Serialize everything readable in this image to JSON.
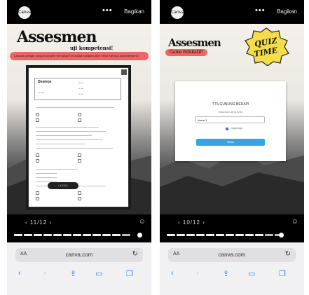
{
  "left": {
    "logo": "Canva",
    "menu_dots": "•••",
    "share": "Bagikan",
    "title": "Assesmen",
    "subtitle": "uji kompetensi!",
    "banner": "Lakukan dengan sunguh-sunguh! Semangat! Ini adalah tahapan akhir untuk menguji kompetensimu!",
    "doc_name": "Desmos",
    "counter": "‹  11/12  ›",
    "pager": "‹  11/12  ›",
    "url": "canva.com",
    "aa": "AA"
  },
  "right": {
    "logo": "Canva",
    "menu_dots": "•••",
    "share": "Bagikan",
    "title": "Assesmen",
    "pill": "Game Edukatif!",
    "quiz_line1": "QUIZ",
    "quiz_line2": "TIME",
    "form_title": "TTS GUNUNG BERAPI",
    "form_sub": "Masukkan nama Anda",
    "input_value": "siswa 1",
    "check_label": "Ingat saya",
    "button": "Mulai",
    "counter": "‹  10/12  ›",
    "url": "canva.com",
    "aa": "AA"
  },
  "colors": {
    "banner_red": "#ef6464",
    "button_blue": "#36a3e8",
    "quiz_yellow": "#f3dd4a",
    "safari_blue": "#2b7de0"
  },
  "icons": [
    "canva-logo-icon",
    "more-dots-icon",
    "prev-icon",
    "next-icon",
    "reaction-icon",
    "refresh-icon",
    "back-icon",
    "forward-icon",
    "share-icon",
    "bookmarks-icon",
    "tabs-icon",
    "fullscreen-icon"
  ]
}
